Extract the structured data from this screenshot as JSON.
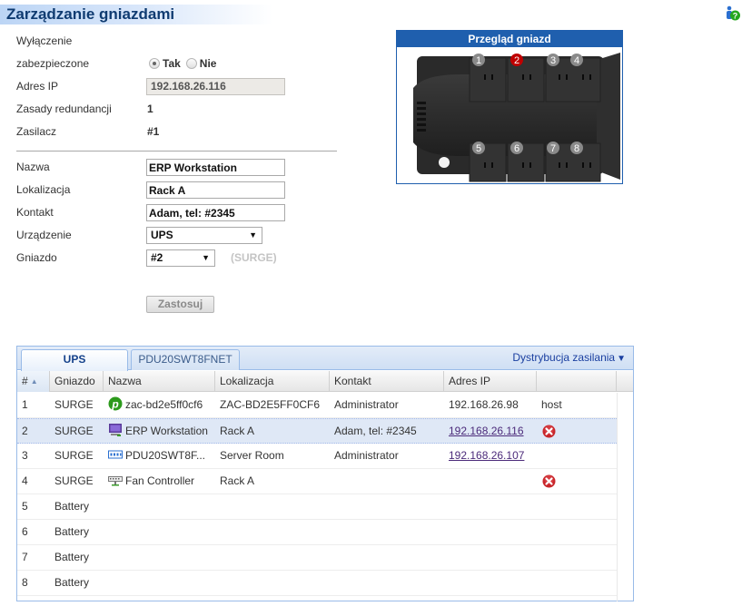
{
  "header": {
    "title": "Zarządzanie gniazdami",
    "help_icon": "help-user-question-icon"
  },
  "form": {
    "shutdown_label_line1": "Wyłączenie",
    "shutdown_label_line2": "zabezpieczone",
    "shutdown_options": [
      {
        "label": "Tak",
        "checked": true
      },
      {
        "label": "Nie",
        "checked": false
      }
    ],
    "ip_label": "Adres IP",
    "ip_value": "192.168.26.116",
    "redundancy_label": "Zasady redundancji",
    "redundancy_value": "1",
    "psu_label": "Zasilacz",
    "psu_value": "#1",
    "name_label": "Nazwa",
    "name_value": "ERP Workstation",
    "location_label": "Lokalizacja",
    "location_value": "Rack A",
    "contact_label": "Kontakt",
    "contact_value": "Adam, tel: #2345",
    "device_label": "Urządzenie",
    "device_value": "UPS",
    "outlet_label": "Gniazdo",
    "outlet_value": "#2",
    "outlet_type_hint": "(SURGE)",
    "apply_button": "Zastosuj"
  },
  "outlet_overview": {
    "title": "Przegląd gniazd",
    "selected_outlet": 2,
    "outlets": [
      "1",
      "2",
      "3",
      "4",
      "5",
      "6",
      "7",
      "8"
    ],
    "colors": {
      "normal": "#8a8a8a",
      "selected": "#c00000"
    }
  },
  "grid": {
    "tabs": [
      {
        "label": "UPS",
        "active": true
      },
      {
        "label": "PDU20SWT8FNET",
        "active": false
      }
    ],
    "power_distribution_menu": "Dystrybucja zasilania",
    "columns": [
      "#",
      "Gniazdo",
      "Nazwa",
      "Lokalizacja",
      "Kontakt",
      "Adres IP",
      ""
    ],
    "sort": {
      "column": "#",
      "direction": "asc"
    },
    "rows": [
      {
        "num": "1",
        "outlet": "SURGE",
        "icon": "p-agent-icon",
        "name": "zac-bd2e5ff0cf6",
        "location": "ZAC-BD2E5FF0CF6",
        "contact": "Administrator",
        "ip": "192.168.26.98",
        "ip_link": false,
        "extra": "host",
        "delete": false,
        "selected": false
      },
      {
        "num": "2",
        "outlet": "SURGE",
        "icon": "workstation-icon",
        "name": "ERP Workstation",
        "location": "Rack A",
        "contact": "Adam, tel: #2345",
        "ip": "192.168.26.116",
        "ip_link": true,
        "extra": "",
        "delete": true,
        "selected": true
      },
      {
        "num": "3",
        "outlet": "SURGE",
        "icon": "pdu-icon",
        "name": "PDU20SWT8F...",
        "location": "Server Room",
        "contact": "Administrator",
        "ip": "192.168.26.107",
        "ip_link": true,
        "extra": "",
        "delete": false,
        "selected": false
      },
      {
        "num": "4",
        "outlet": "SURGE",
        "icon": "network-device-icon",
        "name": "Fan Controller",
        "location": "Rack A",
        "contact": "",
        "ip": "",
        "ip_link": false,
        "extra": "",
        "delete": true,
        "selected": false
      },
      {
        "num": "5",
        "outlet": "Battery",
        "icon": "",
        "name": "",
        "location": "",
        "contact": "",
        "ip": "",
        "ip_link": false,
        "extra": "",
        "delete": false,
        "selected": false
      },
      {
        "num": "6",
        "outlet": "Battery",
        "icon": "",
        "name": "",
        "location": "",
        "contact": "",
        "ip": "",
        "ip_link": false,
        "extra": "",
        "delete": false,
        "selected": false
      },
      {
        "num": "7",
        "outlet": "Battery",
        "icon": "",
        "name": "",
        "location": "",
        "contact": "",
        "ip": "",
        "ip_link": false,
        "extra": "",
        "delete": false,
        "selected": false
      },
      {
        "num": "8",
        "outlet": "Battery",
        "icon": "",
        "name": "",
        "location": "",
        "contact": "",
        "ip": "",
        "ip_link": false,
        "extra": "",
        "delete": false,
        "selected": false
      }
    ]
  }
}
